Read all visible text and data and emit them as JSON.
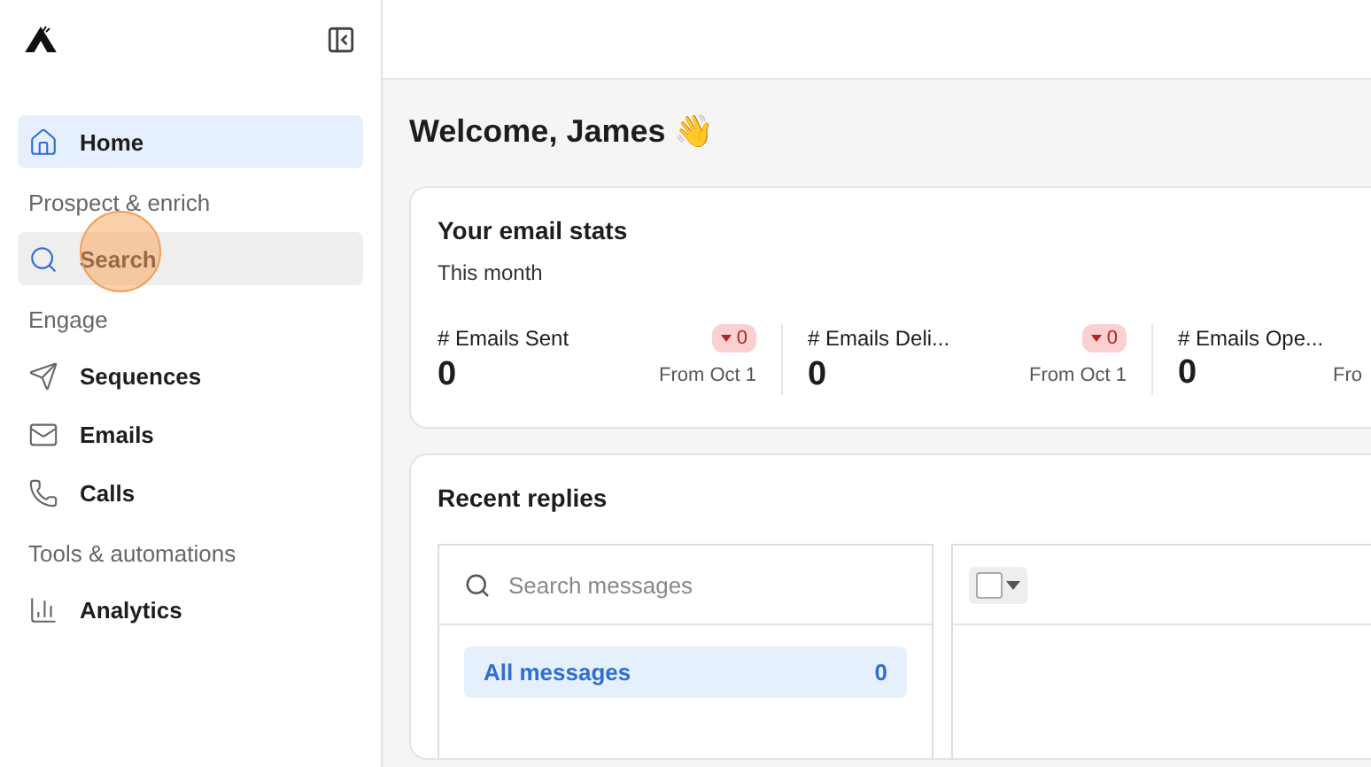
{
  "sidebar": {
    "sections": [
      {
        "items": [
          {
            "label": "Home",
            "selected": true,
            "hovered": false
          }
        ]
      },
      {
        "title": "Prospect & enrich",
        "items": [
          {
            "label": "Search",
            "selected": false,
            "hovered": true
          }
        ]
      },
      {
        "title": "Engage",
        "items": [
          {
            "label": "Sequences",
            "selected": false,
            "hovered": false
          },
          {
            "label": "Emails",
            "selected": false,
            "hovered": false
          },
          {
            "label": "Calls",
            "selected": false,
            "hovered": false
          }
        ]
      },
      {
        "title": "Tools & automations",
        "items": [
          {
            "label": "Analytics",
            "selected": false,
            "hovered": false
          }
        ]
      }
    ]
  },
  "greeting": "Welcome, James 👋",
  "email_stats": {
    "title": "Your email stats",
    "period": "This month",
    "stats": [
      {
        "label": "# Emails Sent",
        "value": "0",
        "change": "0",
        "from": "From Oct 1"
      },
      {
        "label": "# Emails Deli...",
        "value": "0",
        "change": "0",
        "from": "From Oct 1"
      },
      {
        "label": "# Emails Ope...",
        "value": "0",
        "from": "Fro"
      }
    ]
  },
  "recent_replies": {
    "title": "Recent replies",
    "search": {
      "placeholder": "Search messages"
    },
    "folders": [
      {
        "label": "All messages",
        "count": "0",
        "selected": true
      }
    ],
    "select_all": {
      "checked": false
    }
  }
}
